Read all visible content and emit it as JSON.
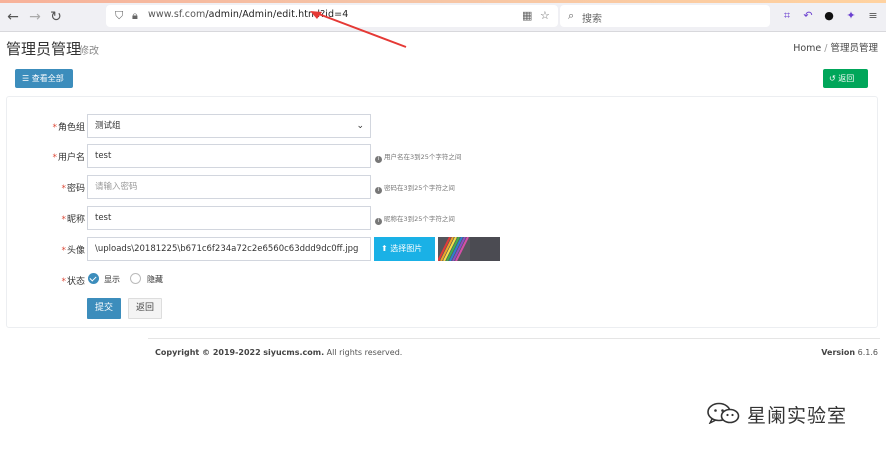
{
  "browser": {
    "url_host": "www.sf.com",
    "url_path": "/admin/Admin/edit.html?id=4",
    "search_placeholder": "搜索"
  },
  "header": {
    "title": "管理员管理",
    "subtitle": "修改",
    "breadcrumb": [
      "Home",
      "管理员管理"
    ]
  },
  "toolbar": {
    "view_all_label": "查看全部",
    "back_label": "返回"
  },
  "form": {
    "role": {
      "label": "角色组",
      "value": "测试组"
    },
    "username": {
      "label": "用户名",
      "value": "test",
      "help": "用户名在3到25个字符之间"
    },
    "password": {
      "label": "密码",
      "placeholder": "请输入密码",
      "help": "密码在3到25个字符之间"
    },
    "nickname": {
      "label": "昵称",
      "value": "test",
      "help": "昵称在3到25个字符之间"
    },
    "avatar": {
      "label": "头像",
      "value": "\\uploads\\20181225\\b671c6f234a72c2e6560c63ddd9dc0ff.jpg",
      "choose_label": "选择图片"
    },
    "status": {
      "label": "状态",
      "options": [
        "显示",
        "隐藏"
      ],
      "selected": "显示"
    },
    "submit_label": "提交",
    "return_label": "返回"
  },
  "footer": {
    "copyright_prefix": "Copyright © 2019-2022",
    "copyright_site": "siyucms.com.",
    "copyright_suffix": "All rights reserved.",
    "version_label": "Version",
    "version_value": "6.1.6"
  },
  "watermark": {
    "text": "星阑实验室"
  },
  "colors": {
    "primary": "#3c8dbc",
    "success": "#00a65a",
    "info": "#1ab1e6",
    "required": "#dd4b39",
    "annotation_arrow": "#e53935"
  }
}
